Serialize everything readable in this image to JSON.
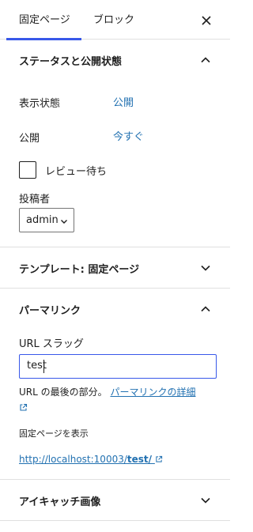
{
  "tabs": {
    "page": "固定ページ",
    "block": "ブロック"
  },
  "status_panel": {
    "title": "ステータスと公開状態",
    "visibility_label": "表示状態",
    "visibility_value": "公開",
    "publish_label": "公開",
    "publish_value": "今すぐ",
    "pending_review_label": "レビュー待ち",
    "pending_review_checked": false,
    "author_label": "投稿者",
    "author_value": "admin"
  },
  "template_panel": {
    "title": "テンプレート: 固定ページ"
  },
  "permalink_panel": {
    "title": "パーマリンク",
    "slug_label": "URL スラッグ",
    "slug_value": "test",
    "help_prefix": "URL の最後の部分。",
    "help_link": "パーマリンクの詳細",
    "view_label": "固定ページを表示",
    "url_prefix": "http://localhost:10003/",
    "url_slug": "test/"
  },
  "featured_image_panel": {
    "title": "アイキャッチ画像"
  },
  "colors": {
    "accent": "#3858e9",
    "link": "#2271b1",
    "text": "#1e1e1e",
    "border": "#e0e0e0"
  }
}
